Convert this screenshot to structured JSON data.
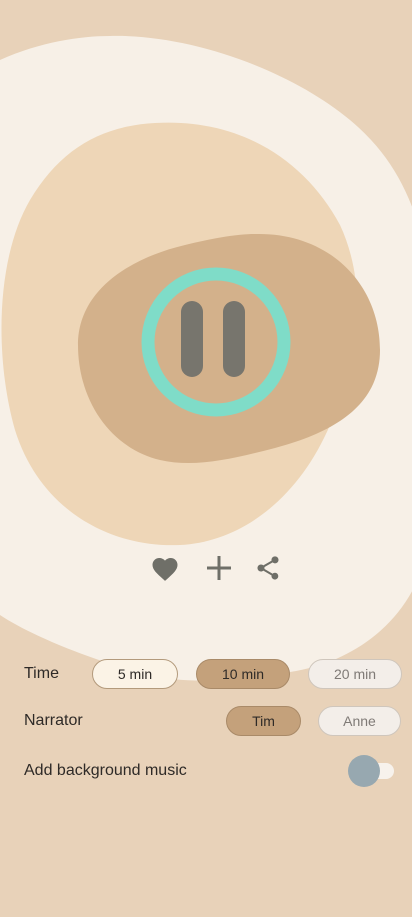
{
  "player": {
    "state": "playing",
    "control_icon": "pause-icon",
    "ring_color": "#7fdcc8",
    "icon_color": "#77756d"
  },
  "actions": [
    {
      "name": "favorite-button",
      "icon": "heart-icon"
    },
    {
      "name": "add-button",
      "icon": "plus-icon"
    },
    {
      "name": "share-button",
      "icon": "share-icon"
    }
  ],
  "settings": {
    "time": {
      "label": "Time",
      "options": [
        "5 min",
        "10 min",
        "20 min"
      ],
      "selected": "10 min"
    },
    "narrator": {
      "label": "Narrator",
      "options": [
        "Tim",
        "Anne"
      ],
      "selected": "Tim"
    },
    "background_music": {
      "label": "Add background music",
      "enabled": false
    }
  },
  "colors": {
    "background": "#e8d2b9",
    "outer_blob": "#f7f0e7",
    "middle_blob": "#eed6b7",
    "inner_blob": "#d3b18b",
    "selected_chip": "#c4a17b",
    "toggle_thumb": "#97a8b0"
  }
}
